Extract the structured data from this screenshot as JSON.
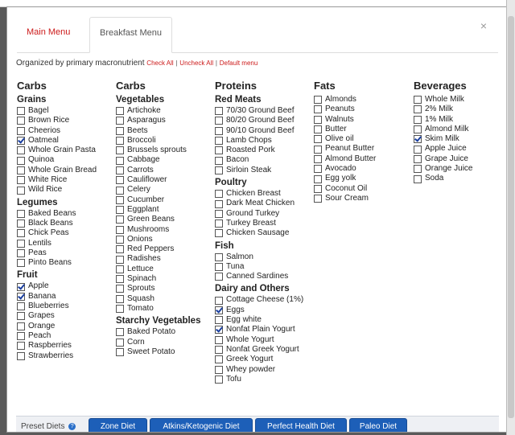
{
  "tabs": {
    "main": "Main Menu",
    "breakfast": "Breakfast Menu"
  },
  "close_glyph": "×",
  "organize": {
    "text": "Organized by primary macronutrient",
    "check_all": "Check All",
    "uncheck_all": "Uncheck All",
    "default_menu": "Default menu",
    "sep": "|"
  },
  "columns": [
    {
      "title": "Carbs",
      "groups": [
        {
          "name": "Grains",
          "items": [
            {
              "label": "Bagel",
              "checked": false
            },
            {
              "label": "Brown Rice",
              "checked": false
            },
            {
              "label": "Cheerios",
              "checked": false
            },
            {
              "label": "Oatmeal",
              "checked": true
            },
            {
              "label": "Whole Grain Pasta",
              "checked": false
            },
            {
              "label": "Quinoa",
              "checked": false
            },
            {
              "label": "Whole Grain Bread",
              "checked": false
            },
            {
              "label": "White Rice",
              "checked": false
            },
            {
              "label": "Wild Rice",
              "checked": false
            }
          ]
        },
        {
          "name": "Legumes",
          "items": [
            {
              "label": "Baked Beans",
              "checked": false
            },
            {
              "label": "Black Beans",
              "checked": false
            },
            {
              "label": "Chick Peas",
              "checked": false
            },
            {
              "label": "Lentils",
              "checked": false
            },
            {
              "label": "Peas",
              "checked": false
            },
            {
              "label": "Pinto Beans",
              "checked": false
            }
          ]
        },
        {
          "name": "Fruit",
          "items": [
            {
              "label": "Apple",
              "checked": true
            },
            {
              "label": "Banana",
              "checked": true
            },
            {
              "label": "Blueberries",
              "checked": false
            },
            {
              "label": "Grapes",
              "checked": false
            },
            {
              "label": "Orange",
              "checked": false
            },
            {
              "label": "Peach",
              "checked": false
            },
            {
              "label": "Raspberries",
              "checked": false
            },
            {
              "label": "Strawberries",
              "checked": false
            }
          ]
        }
      ]
    },
    {
      "title": "Carbs",
      "groups": [
        {
          "name": "Vegetables",
          "items": [
            {
              "label": "Artichoke",
              "checked": false
            },
            {
              "label": "Asparagus",
              "checked": false
            },
            {
              "label": "Beets",
              "checked": false
            },
            {
              "label": "Broccoli",
              "checked": false
            },
            {
              "label": "Brussels sprouts",
              "checked": false
            },
            {
              "label": "Cabbage",
              "checked": false
            },
            {
              "label": "Carrots",
              "checked": false
            },
            {
              "label": "Cauliflower",
              "checked": false
            },
            {
              "label": "Celery",
              "checked": false
            },
            {
              "label": "Cucumber",
              "checked": false
            },
            {
              "label": "Eggplant",
              "checked": false
            },
            {
              "label": "Green Beans",
              "checked": false
            },
            {
              "label": "Mushrooms",
              "checked": false
            },
            {
              "label": "Onions",
              "checked": false
            },
            {
              "label": "Red Peppers",
              "checked": false
            },
            {
              "label": "Radishes",
              "checked": false
            },
            {
              "label": "Lettuce",
              "checked": false
            },
            {
              "label": "Spinach",
              "checked": false
            },
            {
              "label": "Sprouts",
              "checked": false
            },
            {
              "label": "Squash",
              "checked": false
            },
            {
              "label": "Tomato",
              "checked": false
            }
          ]
        },
        {
          "name": "Starchy Vegetables",
          "items": [
            {
              "label": "Baked Potato",
              "checked": false
            },
            {
              "label": "Corn",
              "checked": false
            },
            {
              "label": "Sweet Potato",
              "checked": false
            }
          ]
        }
      ]
    },
    {
      "title": "Proteins",
      "groups": [
        {
          "name": "Red Meats",
          "items": [
            {
              "label": "70/30 Ground Beef",
              "checked": false
            },
            {
              "label": "80/20 Ground Beef",
              "checked": false
            },
            {
              "label": "90/10 Ground Beef",
              "checked": false
            },
            {
              "label": "Lamb Chops",
              "checked": false
            },
            {
              "label": "Roasted Pork",
              "checked": false
            },
            {
              "label": "Bacon",
              "checked": false
            },
            {
              "label": "Sirloin Steak",
              "checked": false
            }
          ]
        },
        {
          "name": "Poultry",
          "items": [
            {
              "label": "Chicken Breast",
              "checked": false
            },
            {
              "label": "Dark Meat Chicken",
              "checked": false
            },
            {
              "label": "Ground Turkey",
              "checked": false
            },
            {
              "label": "Turkey Breast",
              "checked": false
            },
            {
              "label": "Chicken Sausage",
              "checked": false
            }
          ]
        },
        {
          "name": "Fish",
          "items": [
            {
              "label": "Salmon",
              "checked": false
            },
            {
              "label": "Tuna",
              "checked": false
            },
            {
              "label": "Canned Sardines",
              "checked": false
            }
          ]
        },
        {
          "name": "Dairy and Others",
          "items": [
            {
              "label": "Cottage Cheese (1%)",
              "checked": false
            },
            {
              "label": "Eggs",
              "checked": true
            },
            {
              "label": "Egg white",
              "checked": false
            },
            {
              "label": "Nonfat Plain Yogurt",
              "checked": true
            },
            {
              "label": "Whole Yogurt",
              "checked": false
            },
            {
              "label": "Nonfat Greek Yogurt",
              "checked": false
            },
            {
              "label": "Greek Yogurt",
              "checked": false
            },
            {
              "label": "Whey powder",
              "checked": false
            },
            {
              "label": "Tofu",
              "checked": false
            }
          ]
        }
      ]
    },
    {
      "title": "Fats",
      "groups": [
        {
          "name": "",
          "items": [
            {
              "label": "Almonds",
              "checked": false
            },
            {
              "label": "Peanuts",
              "checked": false
            },
            {
              "label": "Walnuts",
              "checked": false
            },
            {
              "label": "Butter",
              "checked": false
            },
            {
              "label": "Olive oil",
              "checked": false
            },
            {
              "label": "Peanut Butter",
              "checked": false
            },
            {
              "label": "Almond Butter",
              "checked": false
            },
            {
              "label": "Avocado",
              "checked": false
            },
            {
              "label": "Egg yolk",
              "checked": false
            },
            {
              "label": "Coconut Oil",
              "checked": false
            },
            {
              "label": "Sour Cream",
              "checked": false
            }
          ]
        }
      ]
    },
    {
      "title": "Beverages",
      "groups": [
        {
          "name": "",
          "items": [
            {
              "label": "Whole Milk",
              "checked": false
            },
            {
              "label": "2% Milk",
              "checked": false
            },
            {
              "label": "1% Milk",
              "checked": false
            },
            {
              "label": "Almond Milk",
              "checked": false
            },
            {
              "label": "Skim Milk",
              "checked": true
            },
            {
              "label": "Apple Juice",
              "checked": false
            },
            {
              "label": "Grape Juice",
              "checked": false
            },
            {
              "label": "Orange Juice",
              "checked": false
            },
            {
              "label": "Soda",
              "checked": false
            }
          ]
        }
      ]
    }
  ],
  "footer": {
    "label": "Preset Diets",
    "help_glyph": "?",
    "buttons": [
      "Zone Diet",
      "Atkins/Ketogenic Diet",
      "Perfect Health Diet",
      "Paleo Diet"
    ]
  }
}
